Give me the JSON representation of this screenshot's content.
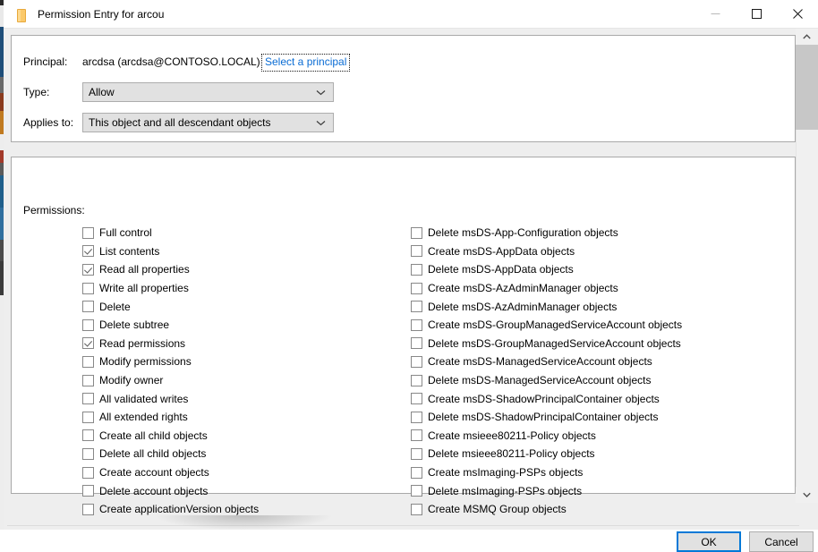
{
  "window": {
    "title": "Permission Entry for arcou",
    "icon": "folder-icon",
    "controls": {
      "minimize": "minimize-icon",
      "maximize": "maximize-icon",
      "close": "close-icon"
    }
  },
  "principal_group": {
    "principal_label": "Principal:",
    "principal_value": "arcdsa (arcdsa@CONTOSO.LOCAL)",
    "select_principal_link": "Select a principal",
    "type_label": "Type:",
    "type_value": "Allow",
    "applies_to_label": "Applies to:",
    "applies_to_value": "This object and all descendant objects"
  },
  "permissions_group": {
    "label": "Permissions:",
    "left_column": [
      {
        "label": "Full control",
        "checked": false
      },
      {
        "label": "List contents",
        "checked": true
      },
      {
        "label": "Read all properties",
        "checked": true
      },
      {
        "label": "Write all properties",
        "checked": false
      },
      {
        "label": "Delete",
        "checked": false
      },
      {
        "label": "Delete subtree",
        "checked": false
      },
      {
        "label": "Read permissions",
        "checked": true
      },
      {
        "label": "Modify permissions",
        "checked": false
      },
      {
        "label": "Modify owner",
        "checked": false
      },
      {
        "label": "All validated writes",
        "checked": false
      },
      {
        "label": "All extended rights",
        "checked": false
      },
      {
        "label": "Create all child objects",
        "checked": false
      },
      {
        "label": "Delete all child objects",
        "checked": false
      },
      {
        "label": "Create account objects",
        "checked": false
      },
      {
        "label": "Delete account objects",
        "checked": false
      },
      {
        "label": "Create applicationVersion objects",
        "checked": false
      }
    ],
    "right_column": [
      {
        "label": "Delete msDS-App-Configuration objects",
        "checked": false
      },
      {
        "label": "Create msDS-AppData objects",
        "checked": false
      },
      {
        "label": "Delete msDS-AppData objects",
        "checked": false
      },
      {
        "label": "Create msDS-AzAdminManager objects",
        "checked": false
      },
      {
        "label": "Delete msDS-AzAdminManager objects",
        "checked": false
      },
      {
        "label": "Create msDS-GroupManagedServiceAccount objects",
        "checked": false
      },
      {
        "label": "Delete msDS-GroupManagedServiceAccount objects",
        "checked": false
      },
      {
        "label": "Create msDS-ManagedServiceAccount objects",
        "checked": false
      },
      {
        "label": "Delete msDS-ManagedServiceAccount objects",
        "checked": false
      },
      {
        "label": "Create msDS-ShadowPrincipalContainer objects",
        "checked": false
      },
      {
        "label": "Delete msDS-ShadowPrincipalContainer objects",
        "checked": false
      },
      {
        "label": "Create msieee80211-Policy objects",
        "checked": false
      },
      {
        "label": "Delete msieee80211-Policy objects",
        "checked": false
      },
      {
        "label": "Create msImaging-PSPs objects",
        "checked": false
      },
      {
        "label": "Delete msImaging-PSPs objects",
        "checked": false
      },
      {
        "label": "Create MSMQ Group objects",
        "checked": false
      }
    ]
  },
  "footer": {
    "ok_label": "OK",
    "cancel_label": "Cancel"
  },
  "colors": {
    "accent": "#0078d7",
    "link": "#0a6cd4",
    "dialog_bg": "#eeeeee",
    "groupbox_bg": "#ffffff",
    "control_fill": "#e1e1e1",
    "border": "#a9a9a9",
    "scrollbar_thumb": "#c7c7c7"
  }
}
